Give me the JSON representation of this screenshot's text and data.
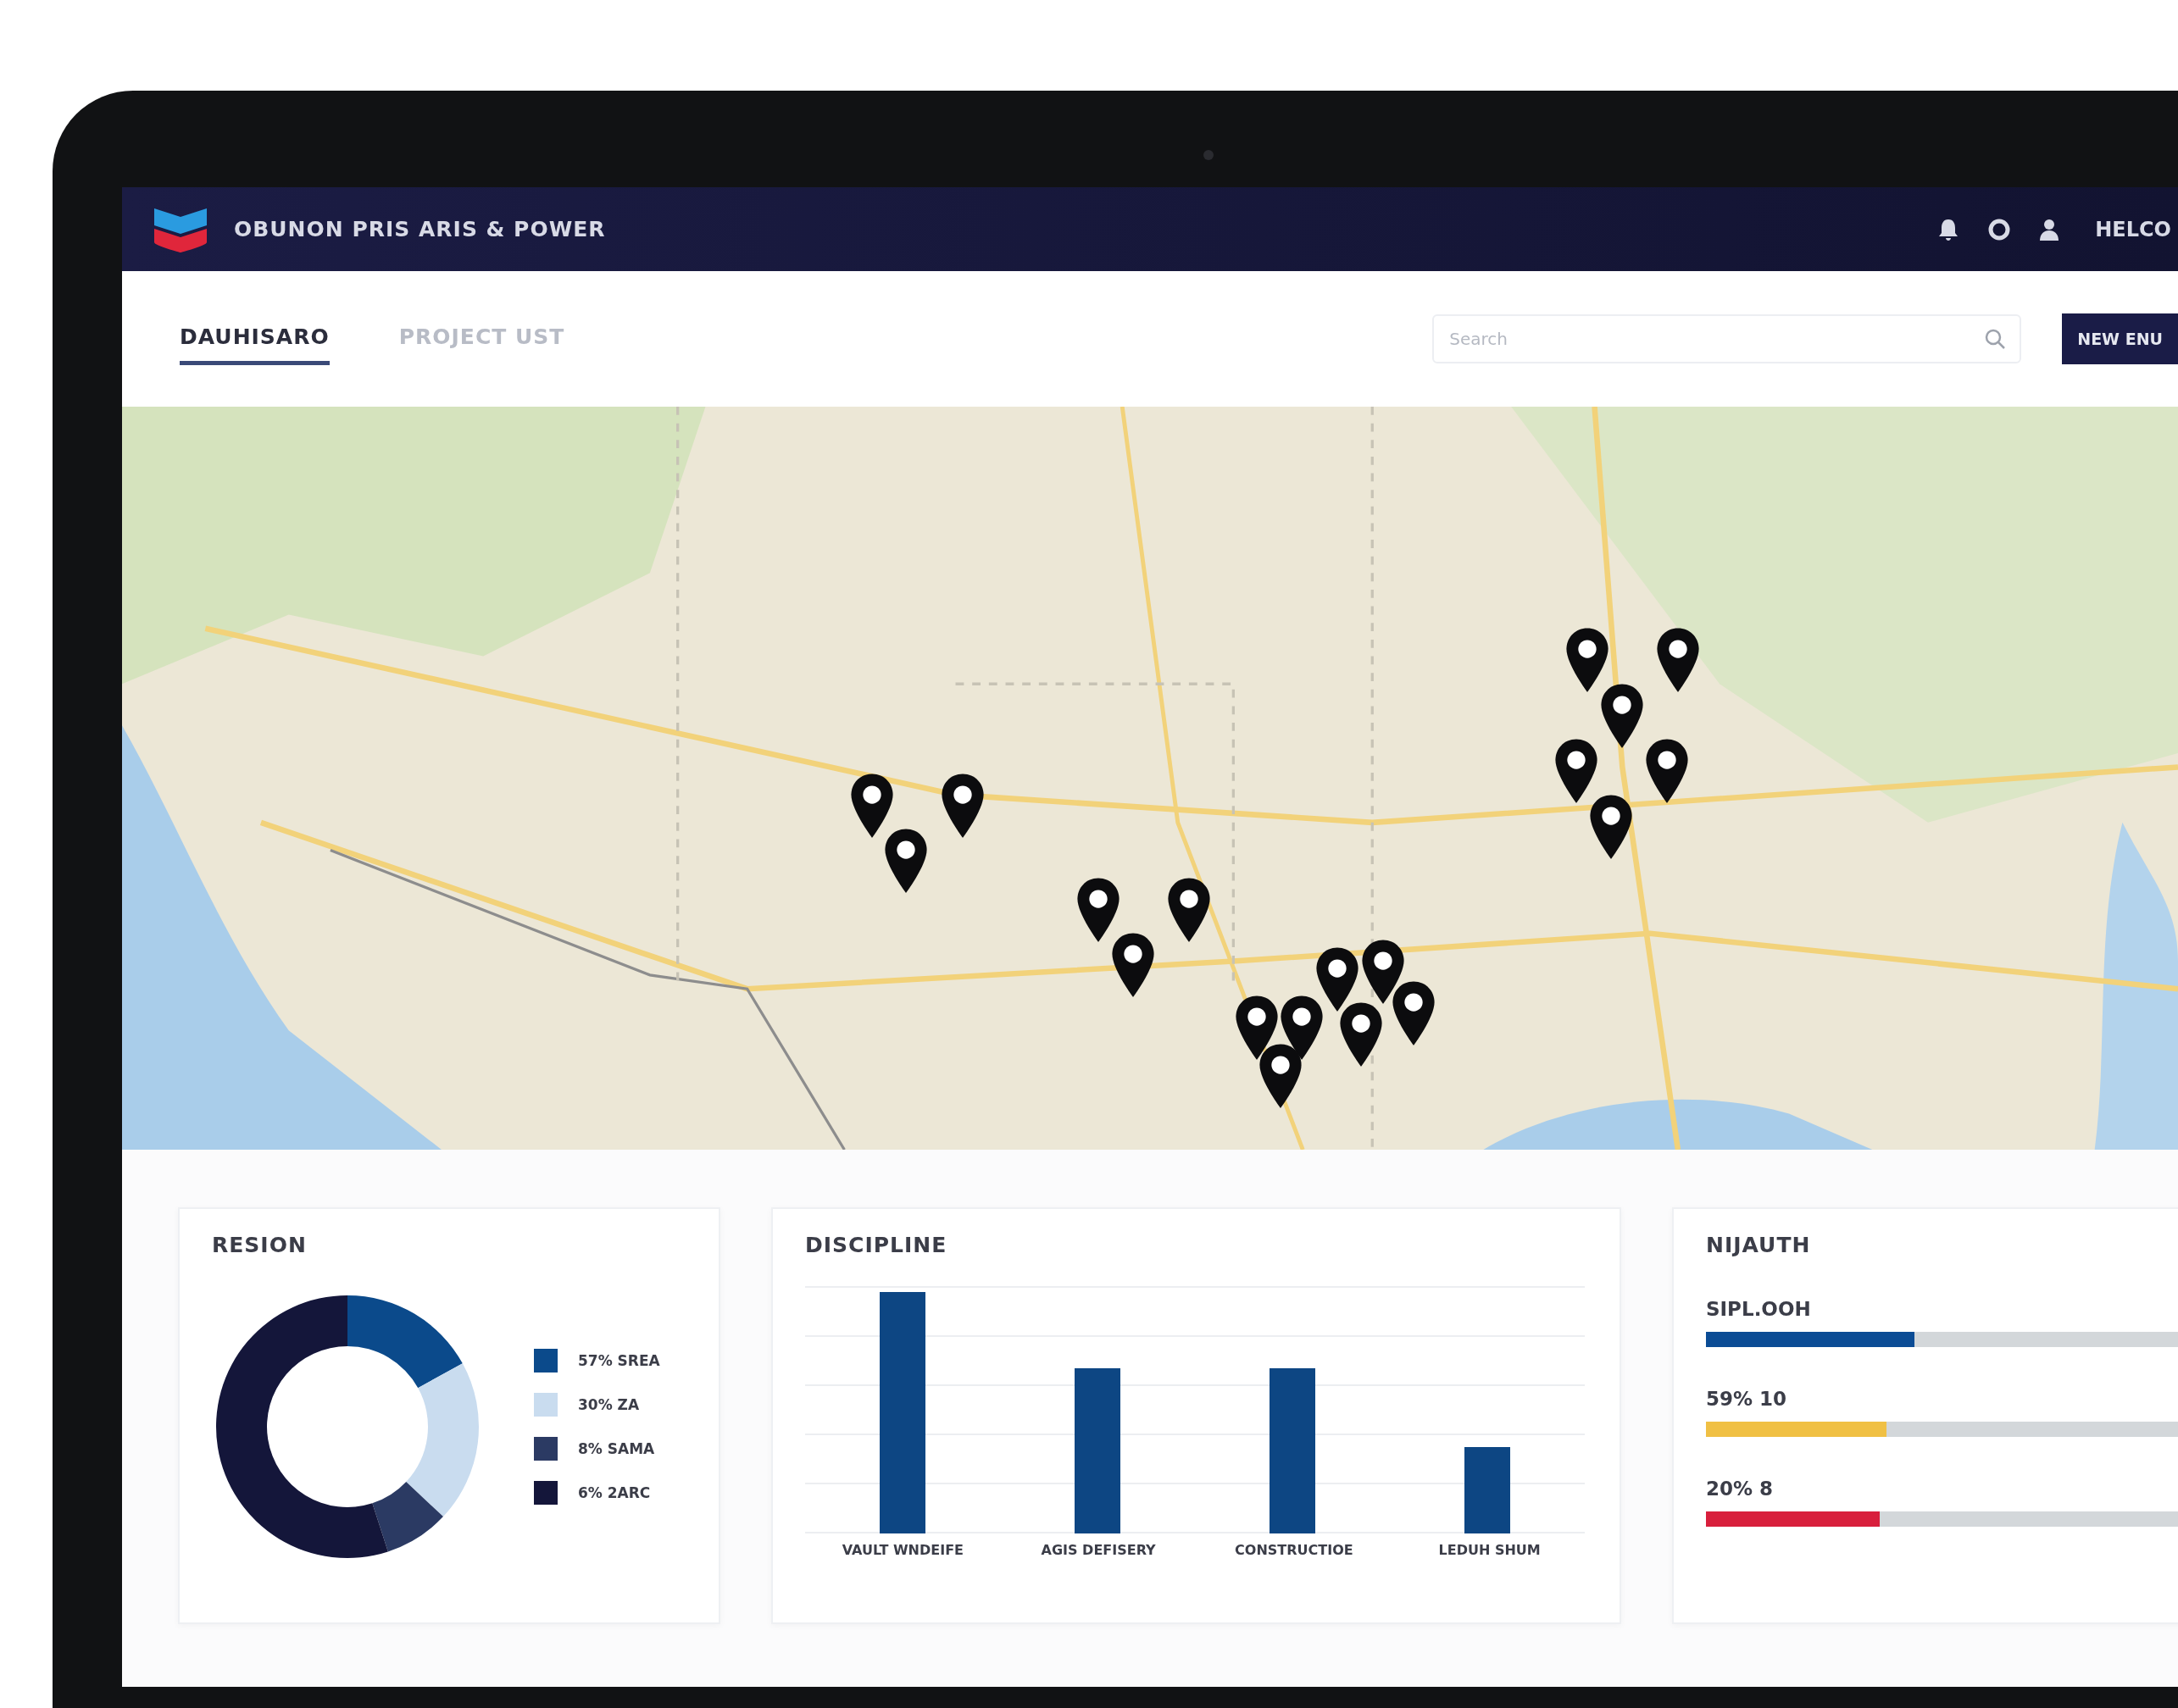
{
  "header": {
    "title": "OBUNON PRIS ARIS & POWER",
    "user": "HELCO"
  },
  "tabs": [
    {
      "label": "DAUHISARO",
      "selected": true
    },
    {
      "label": "PROJECT UST",
      "selected": false
    }
  ],
  "search": {
    "placeholder": "Search"
  },
  "action_button": "NEW ENU",
  "region": {
    "title": "RESION",
    "legend": [
      {
        "label": "57% SREA",
        "color": "#0b4a8b"
      },
      {
        "label": "30% ZA",
        "color": "#c9dcef"
      },
      {
        "label": "8% SAMA",
        "color": "#2b3a63"
      },
      {
        "label": "6% 2ARC",
        "color": "#14163a"
      }
    ]
  },
  "discipline": {
    "title": "DISCIPLINE",
    "categories": [
      "VAULT WNDEIFE",
      "AGIS DEFISERY",
      "CONSTRUCTIOE",
      "LEDUH SHUM"
    ]
  },
  "health": {
    "title": "NIJAUTH",
    "bars": [
      {
        "label": "SIPL.OOH",
        "level": 0.3,
        "color": "#0b4c95"
      },
      {
        "label": "59% 10",
        "level": 0.26,
        "color": "#f0c044"
      },
      {
        "label": "20% 8",
        "level": 0.25,
        "color": "#d81f3c"
      }
    ]
  }
}
